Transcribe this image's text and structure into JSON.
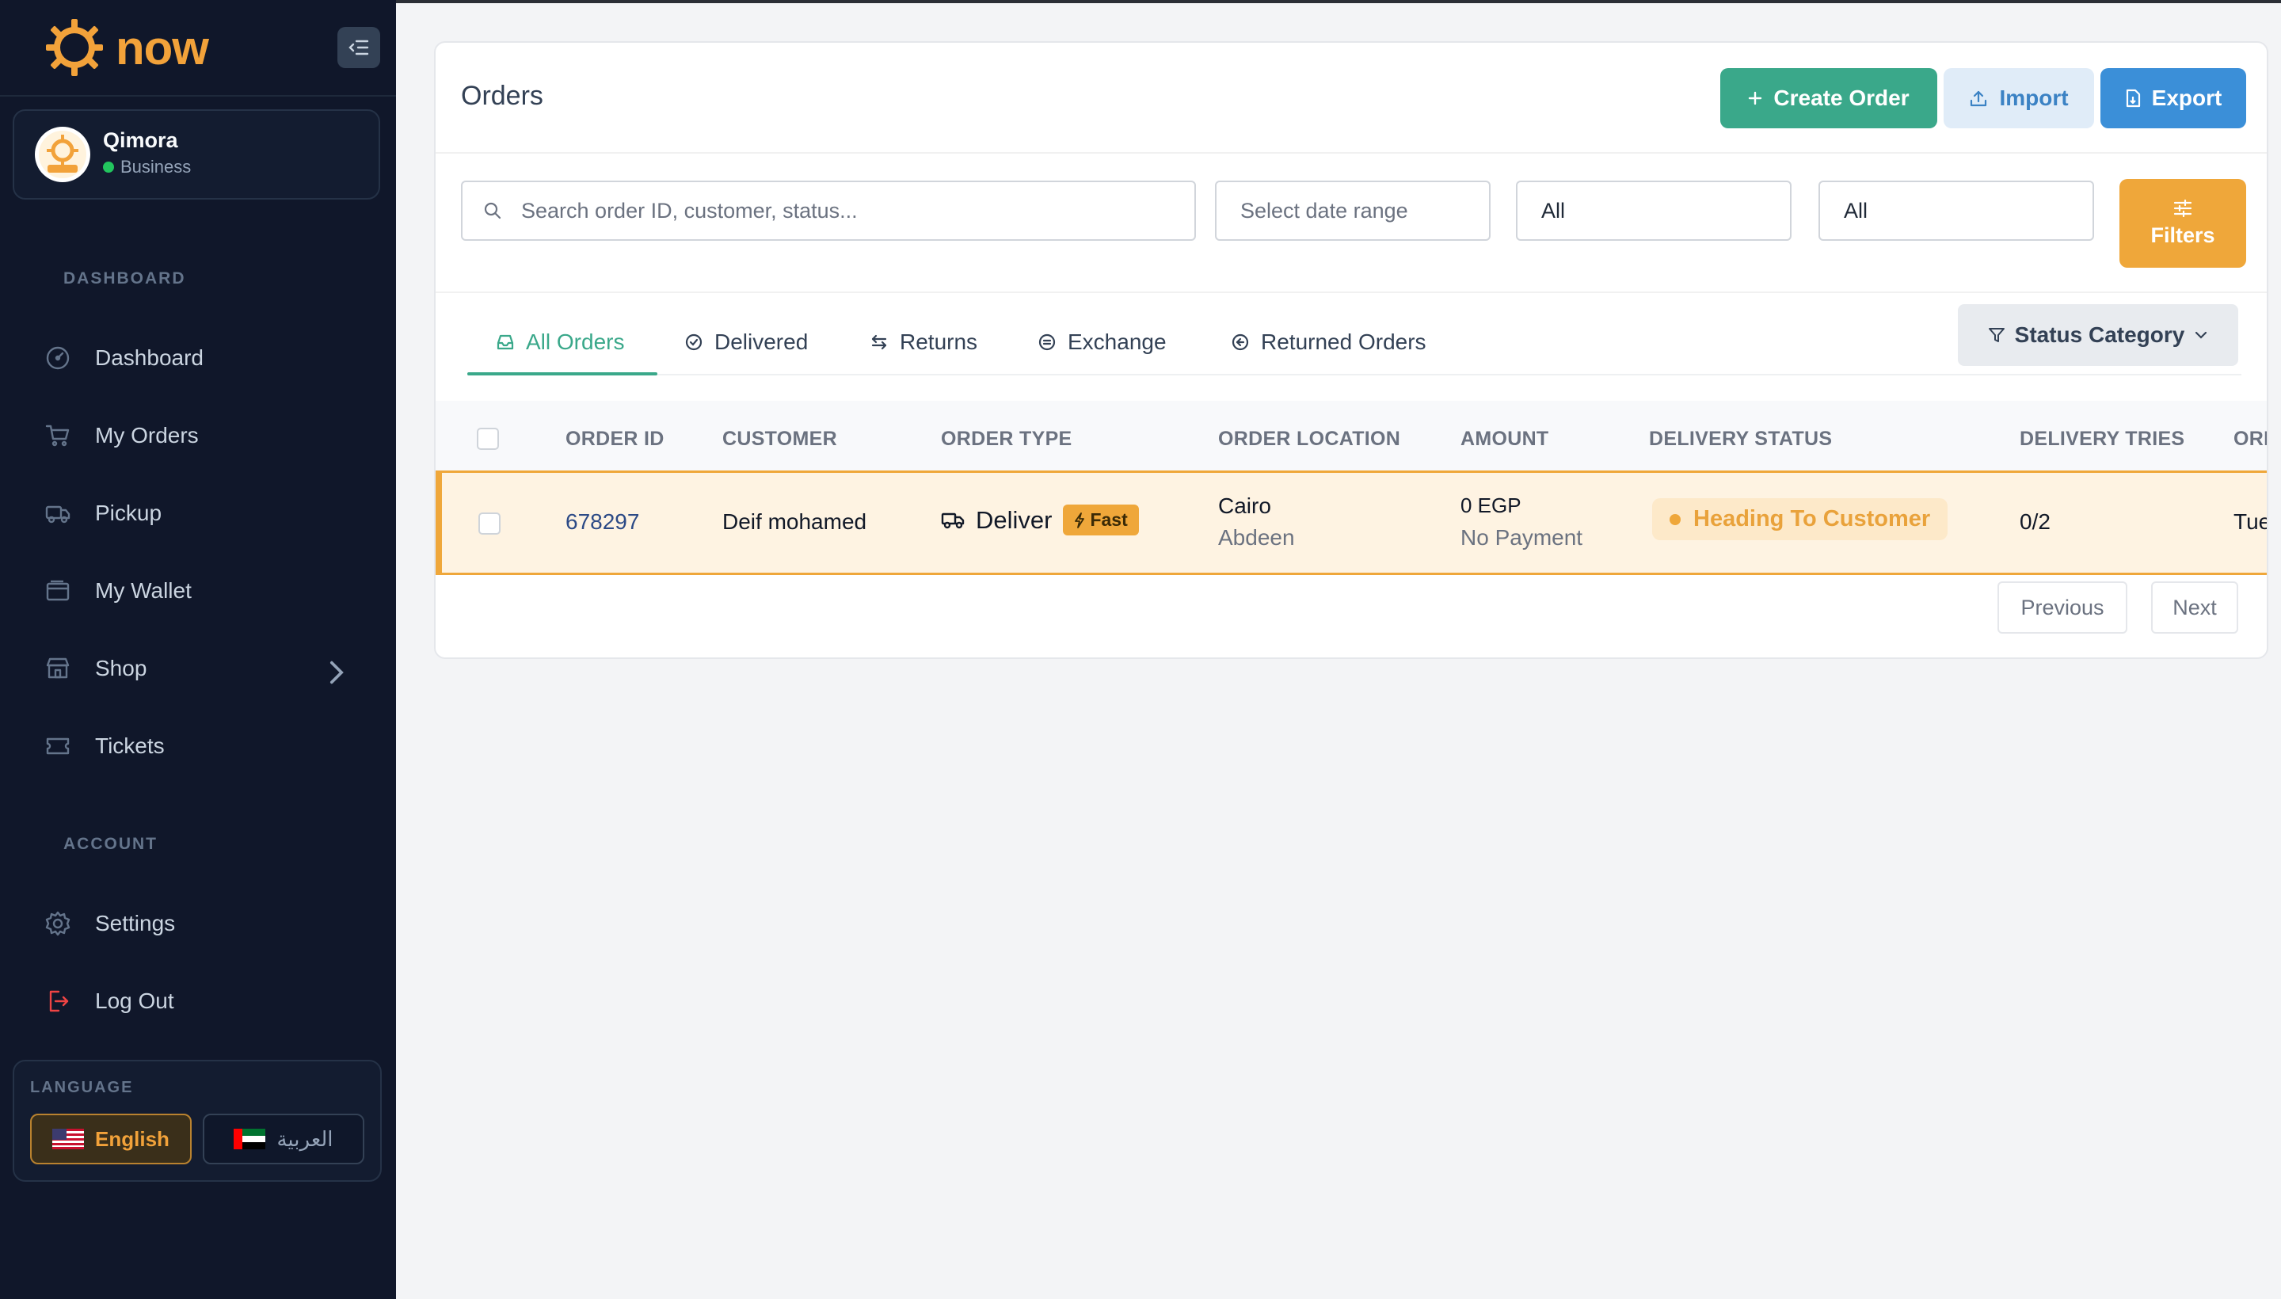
{
  "brand": {
    "name": "now",
    "color": "#f2a23a"
  },
  "account": {
    "name": "Qimora",
    "type": "Business"
  },
  "sidebar": {
    "sections": {
      "dashboard": "DASHBOARD",
      "account": "ACCOUNT"
    },
    "items": [
      {
        "label": "Dashboard",
        "icon": "gauge-icon"
      },
      {
        "label": "My Orders",
        "icon": "cart-icon"
      },
      {
        "label": "Pickup",
        "icon": "truck-icon"
      },
      {
        "label": "My Wallet",
        "icon": "wallet-icon"
      },
      {
        "label": "Shop",
        "icon": "store-icon"
      },
      {
        "label": "Tickets",
        "icon": "ticket-icon"
      }
    ],
    "account_items": [
      {
        "label": "Settings",
        "icon": "gear-icon"
      },
      {
        "label": "Log Out",
        "icon": "logout-icon"
      }
    ]
  },
  "language": {
    "label": "LANGUAGE",
    "english": "English",
    "arabic": "العربية",
    "selected": "English"
  },
  "orders": {
    "title": "Orders",
    "buttons": {
      "create": "Create Order",
      "import": "Import",
      "export": "Export",
      "filters": "Filters"
    },
    "search_placeholder": "Search order ID, customer, status...",
    "date_placeholder": "Select date range",
    "select1": "All",
    "select2": "All",
    "tabs": [
      "All Orders",
      "Delivered",
      "Returns",
      "Exchange",
      "Returned Orders"
    ],
    "active_tab": "All Orders",
    "status_category": "Status Category",
    "columns": [
      "ORDER ID",
      "CUSTOMER",
      "ORDER TYPE",
      "ORDER LOCATION",
      "AMOUNT",
      "DELIVERY STATUS",
      "DELIVERY TRIES",
      "ORI"
    ],
    "rows": [
      {
        "order_id": "678297",
        "customer": "Deif mohamed",
        "order_type": "Deliver",
        "badge": "Fast",
        "city": "Cairo",
        "area": "Abdeen",
        "amount": "0 EGP",
        "payment": "No Payment",
        "status": "Heading To Customer",
        "tries": "0/2",
        "date_partial": "Tue"
      }
    ],
    "pagination": {
      "previous": "Previous",
      "next": "Next"
    }
  },
  "colors": {
    "sidebar_bg": "#10172a",
    "primary_green": "#3aa88a",
    "accent_orange": "#efa73a",
    "export_blue": "#3b8fd8"
  }
}
